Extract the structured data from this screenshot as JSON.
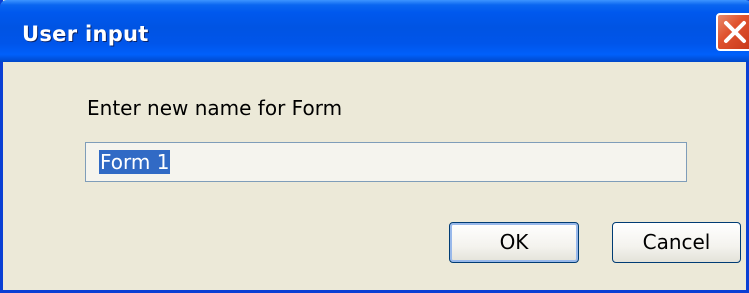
{
  "window": {
    "title": "User input"
  },
  "dialog": {
    "prompt": "Enter new name for Form",
    "input_value": "Form 1",
    "ok_label": "OK",
    "cancel_label": "Cancel"
  },
  "icons": {
    "close": "close-icon"
  },
  "colors": {
    "titlebar": "#0054e3",
    "close_button": "#e0532f",
    "dialog_background": "#ece9d8",
    "selection_highlight": "#316ac5",
    "button_border": "#003c74"
  }
}
